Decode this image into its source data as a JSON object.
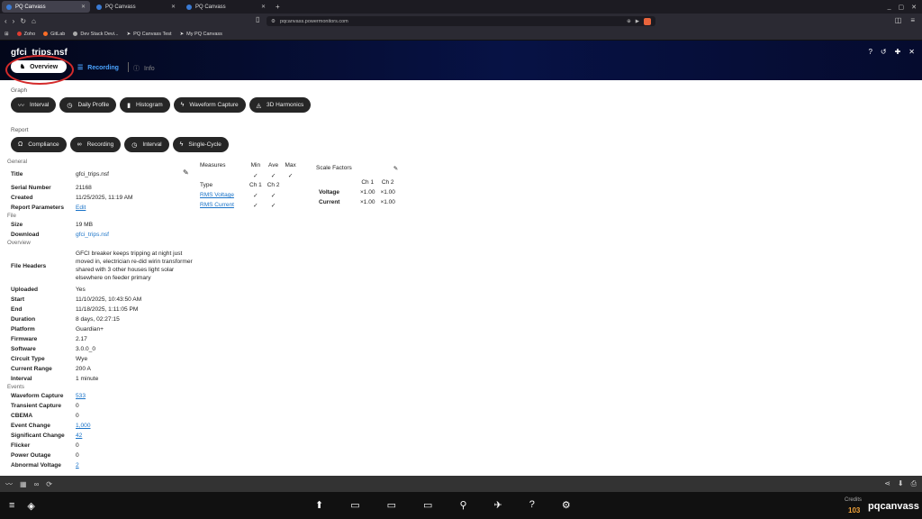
{
  "browser": {
    "tabs": [
      "PQ Canvass",
      "PQ Canvass",
      "PQ Canvass"
    ],
    "url": "pqcanvass.powermonitors.com",
    "bookmarks": [
      "Zoho",
      "GitLab",
      "Dev Stack Devi...",
      "PQ Canvass Test",
      "My PQ Canvass"
    ]
  },
  "app": {
    "filename": "gfci_trips.nsf",
    "tabs": {
      "overview": "Overview",
      "recording": "Recording",
      "info": "Info"
    }
  },
  "graph": {
    "label": "Graph",
    "buttons": [
      "Interval",
      "Daily Profile",
      "Histogram",
      "Waveform Capture",
      "3D Harmonics"
    ]
  },
  "report": {
    "label": "Report",
    "buttons": [
      "Compliance",
      "Recording",
      "Interval",
      "Single-Cycle"
    ]
  },
  "general": {
    "label": "General",
    "rows": [
      {
        "k": "Title",
        "v": "gfci_trips.nsf"
      },
      {
        "k": "Serial Number",
        "v": "21168"
      },
      {
        "k": "Created",
        "v": "11/25/2025, 11:19 AM"
      },
      {
        "k": "Report Parameters",
        "v": "Edit"
      }
    ]
  },
  "file": {
    "label": "File",
    "rows": [
      {
        "k": "Size",
        "v": "19 MB"
      },
      {
        "k": "Download",
        "v": "gfci_trips.nsf"
      }
    ]
  },
  "overview": {
    "label": "Overview",
    "file_headers_label": "File Headers",
    "file_headers": "GFCI breaker keeps tripping at night just moved in, electrician re-did wirin transformer shared with 3 other houses light solar elsewhere on feeder primary",
    "rows": [
      {
        "k": "Uploaded",
        "v": "Yes"
      },
      {
        "k": "Start",
        "v": "11/10/2025, 10:43:50 AM"
      },
      {
        "k": "End",
        "v": "11/18/2025, 1:11:05 PM"
      },
      {
        "k": "Duration",
        "v": "8 days, 02:27:15"
      },
      {
        "k": "Platform",
        "v": "Guardian+"
      },
      {
        "k": "Firmware",
        "v": "2.17"
      },
      {
        "k": "Software",
        "v": "3.0.0_0"
      },
      {
        "k": "Circuit Type",
        "v": "Wye"
      },
      {
        "k": "Current Range",
        "v": "200 A"
      },
      {
        "k": "Interval",
        "v": "1 minute"
      }
    ]
  },
  "events": {
    "label": "Events",
    "rows": [
      {
        "k": "Waveform Capture",
        "v": "533"
      },
      {
        "k": "Transient Capture",
        "v": "0"
      },
      {
        "k": "CBEMA",
        "v": "0"
      },
      {
        "k": "Event Change",
        "v": "1,000"
      },
      {
        "k": "Significant Change",
        "v": "42"
      },
      {
        "k": "Flicker",
        "v": "0"
      },
      {
        "k": "Power Outage",
        "v": "0"
      },
      {
        "k": "Abnormal Voltage",
        "v": "2"
      }
    ]
  },
  "measures": {
    "label": "Measures",
    "cols": [
      "Min",
      "Ave",
      "Max"
    ],
    "type_label": "Type",
    "ch1": "Ch 1",
    "ch2": "Ch 2",
    "rows": [
      "RMS Voltage",
      "RMS Current"
    ],
    "check": "✓"
  },
  "scale": {
    "label": "Scale Factors",
    "ch1": "Ch 1",
    "ch2": "Ch 2",
    "rows": [
      {
        "k": "Voltage",
        "c1": "×1.00",
        "c2": "×1.00"
      },
      {
        "k": "Current",
        "c1": "×1.00",
        "c2": "×1.00"
      }
    ]
  },
  "footer": {
    "credits_label": "Credits",
    "credits": "103",
    "brand": "pqcanvass"
  }
}
